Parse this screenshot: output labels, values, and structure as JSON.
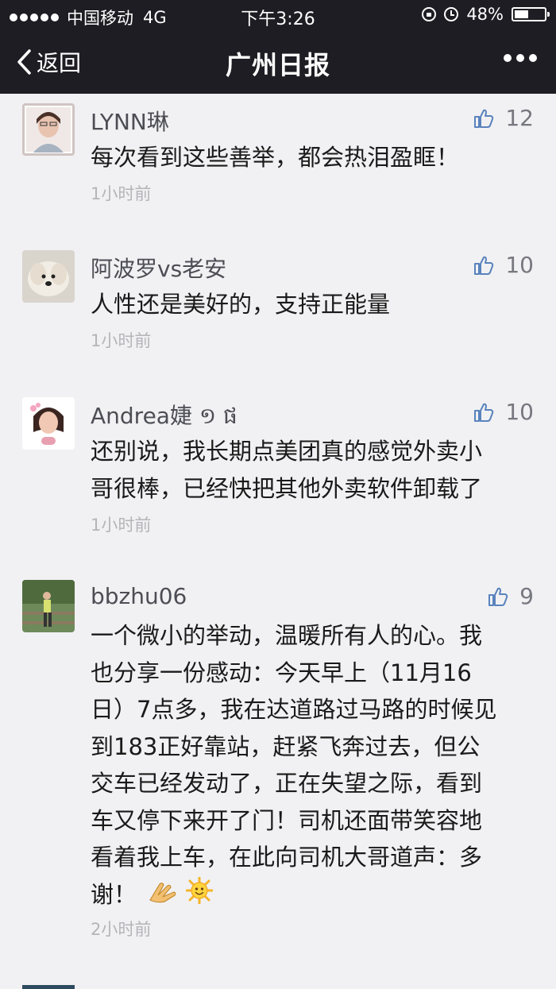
{
  "status_bar": {
    "carrier": "中国移动",
    "network": "4G",
    "time": "下午3:26",
    "battery": "48%",
    "battery_level": 0.48
  },
  "nav": {
    "back_label": "返回",
    "title": "广州日报"
  },
  "comments": [
    {
      "author": "LYNN琳",
      "likes": "12",
      "text": "每次看到这些善举，都会热泪盈眶！",
      "time": "1小时前"
    },
    {
      "author": "阿波罗vs老安",
      "likes": "10",
      "text": "人性还是美好的，支持正能量",
      "time": "1小时前"
    },
    {
      "author": "Andrea婕 ១ ផ",
      "likes": "10",
      "lines": [
        "还别说，我长期点美团真的感觉外卖小",
        "哥很棒，已经快把其他外卖软件卸载了"
      ],
      "time": "1小时前"
    },
    {
      "author": "bbzhu06",
      "likes": "9",
      "lines": [
        "一个微小的举动，温暖所有人的心。我",
        "也分享一份感动：今天早上（11月16",
        "日）7点多，我在达道路过马路的时候见",
        "到183正好靠站，赶紧飞奔过去，但公",
        "交车已经发动了，正在失望之际，看到",
        "车又停下来开了门！司机还面带笑容地",
        "看着我上车，在此向司机大哥道声：多",
        "谢！"
      ],
      "time": "2小时前"
    }
  ],
  "colors": {
    "bar_bg": "#1e1d23",
    "page_bg": "#f1f1f3",
    "like_icon": "#5a83bd"
  },
  "icons": [
    "back-arrow-icon",
    "more-icon",
    "thumbs-up-icon",
    "lock-rotation-icon",
    "alarm-icon",
    "battery-icon",
    "clap-emoji-icon",
    "sun-emoji-icon"
  ]
}
